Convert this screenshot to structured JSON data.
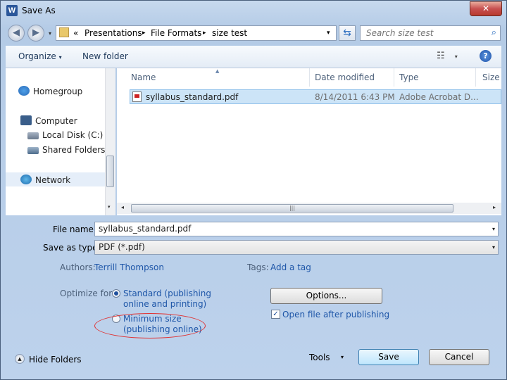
{
  "window": {
    "title": "Save As",
    "app_icon_letter": "W",
    "close_glyph": "✕"
  },
  "nav": {
    "back_glyph": "◀",
    "forward_glyph": "▶",
    "dropdown_glyph": "▾",
    "breadcrumb_prefix": "«",
    "breadcrumb": [
      "Presentations",
      "File Formats",
      "size test"
    ],
    "separator": "▸",
    "refresh_glyph": "⇆",
    "search_placeholder": "Search size test",
    "search_glyph": "⌕"
  },
  "toolbar": {
    "organize_label": "Organize",
    "new_folder_label": "New folder",
    "view_glyph": "☷",
    "help_glyph": "?"
  },
  "sidebar": {
    "items": [
      {
        "label": "Homegroup",
        "icon": "homegroup-icon"
      },
      {
        "label": "Computer",
        "icon": "computer-icon"
      },
      {
        "label": "Local Disk (C:)",
        "icon": "drive-icon"
      },
      {
        "label": "Shared Folders (\\",
        "icon": "shared-folder-icon"
      },
      {
        "label": "Network",
        "icon": "network-icon"
      }
    ]
  },
  "filelist": {
    "columns": [
      "Name",
      "Date modified",
      "Type",
      "Size"
    ],
    "rows": [
      {
        "name": "syllabus_standard.pdf",
        "date": "8/14/2011 6:43 PM",
        "type": "Adobe Acrobat D..."
      }
    ]
  },
  "form": {
    "file_name_label": "File name:",
    "file_name_value": "syllabus_standard.pdf",
    "type_label": "Save as type:",
    "type_value": "PDF (*.pdf)",
    "authors_label": "Authors:",
    "authors_value": "Terrill Thompson",
    "tags_label": "Tags:",
    "tags_value": "Add a tag",
    "optimize_label": "Optimize for:",
    "opt_standard_line1": "Standard (publishing",
    "opt_standard_line2": "online and printing)",
    "opt_minimum_line1": "Minimum size",
    "opt_minimum_line2": "(publishing online)",
    "options_label": "Options...",
    "open_after_label": "Open file after publishing",
    "open_after_checked": true
  },
  "footer": {
    "hide_folders_label": "Hide Folders",
    "tools_label": "Tools",
    "save_label": "Save",
    "cancel_label": "Cancel"
  },
  "colors": {
    "selection": "#cce4f7",
    "link": "#1e56a8",
    "annotation": "#e03131"
  }
}
